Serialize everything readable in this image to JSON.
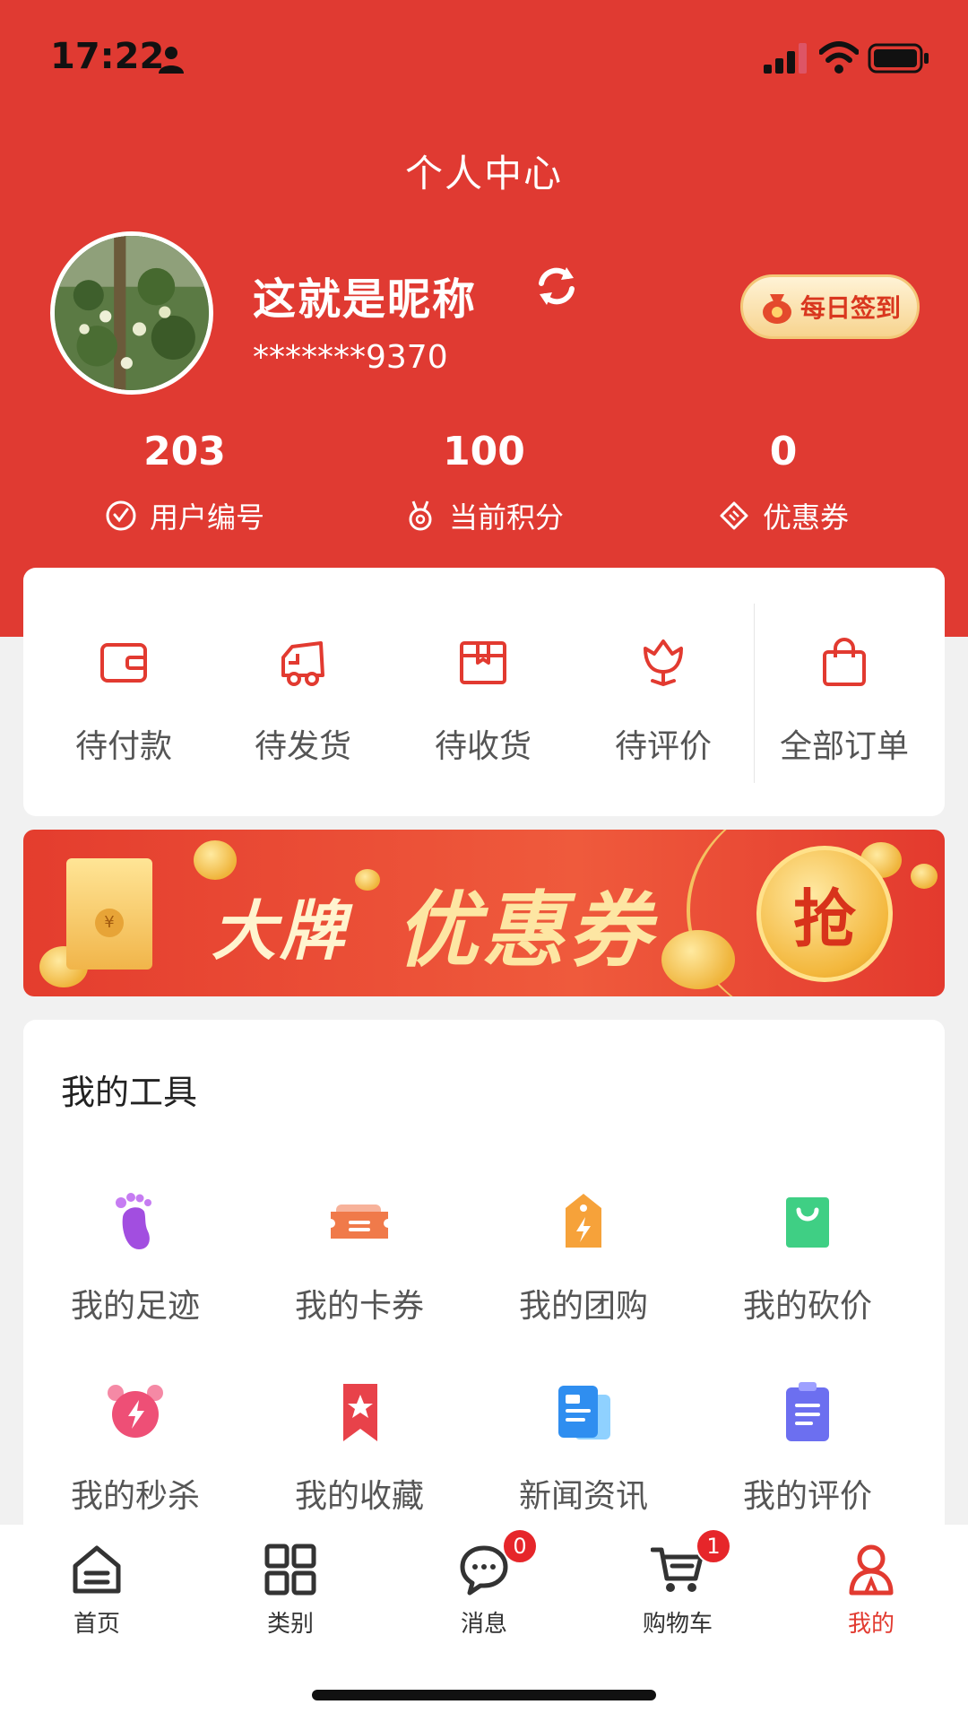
{
  "status_bar": {
    "time": "17:22"
  },
  "header": {
    "title": "个人中心"
  },
  "profile": {
    "nickname": "这就是昵称",
    "account": "*******9370",
    "checkin_label": "每日签到"
  },
  "stats": [
    {
      "value": "203",
      "label": "用户编号",
      "icon": "clock-check-icon"
    },
    {
      "value": "100",
      "label": "当前积分",
      "icon": "medal-icon"
    },
    {
      "value": "0",
      "label": "优惠券",
      "icon": "coupon-ticket-icon"
    }
  ],
  "orders": [
    {
      "label": "待付款",
      "icon": "wallet-icon"
    },
    {
      "label": "待发货",
      "icon": "truck-icon"
    },
    {
      "label": "待收货",
      "icon": "package-icon"
    },
    {
      "label": "待评价",
      "icon": "flower-icon"
    },
    {
      "label": "全部订单",
      "icon": "shopping-bag-icon"
    }
  ],
  "banner": {
    "text_brand": "大牌",
    "text_coupon": "优惠券",
    "grab_label": "抢",
    "yen_symbol": "¥"
  },
  "tools": {
    "title": "我的工具",
    "items": [
      {
        "label": "我的足迹",
        "icon": "footprint-icon"
      },
      {
        "label": "我的卡券",
        "icon": "ticket-icon"
      },
      {
        "label": "我的团购",
        "icon": "price-tag-icon"
      },
      {
        "label": "我的砍价",
        "icon": "shopping-bag-icon"
      },
      {
        "label": "我的秒杀",
        "icon": "alarm-clock-icon"
      },
      {
        "label": "我的收藏",
        "icon": "bookmark-star-icon"
      },
      {
        "label": "新闻资讯",
        "icon": "news-document-icon"
      },
      {
        "label": "我的评价",
        "icon": "clipboard-icon"
      }
    ]
  },
  "tab_bar": {
    "items": [
      {
        "label": "首页",
        "icon": "home-icon"
      },
      {
        "label": "类别",
        "icon": "grid-icon"
      },
      {
        "label": "消息",
        "icon": "chat-bubble-icon",
        "badge": "0"
      },
      {
        "label": "购物车",
        "icon": "cart-icon",
        "badge": "1"
      },
      {
        "label": "我的",
        "icon": "user-icon",
        "active": true
      }
    ]
  },
  "colors": {
    "primary": "#e03a32",
    "background": "#f1f1f1",
    "gold": "#f3b73c"
  }
}
